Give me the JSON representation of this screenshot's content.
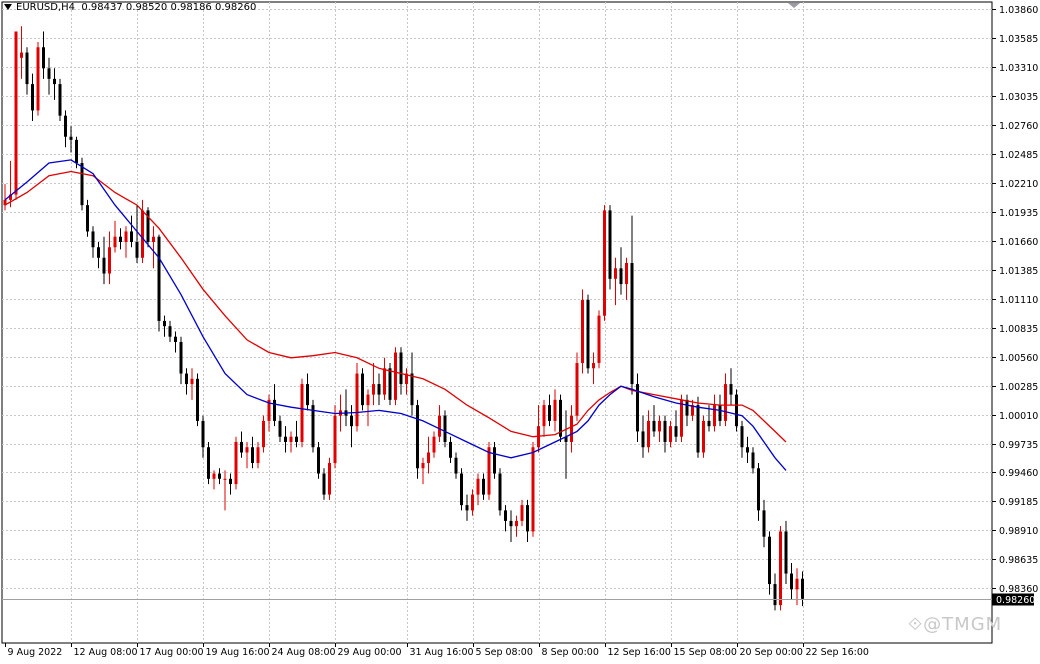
{
  "header": {
    "symbol": "EURUSD,H4",
    "ohlc": "0.98437 0.98520 0.98186 0.98260"
  },
  "watermark": "⟐@TMGM",
  "colors": {
    "background": "#ffffff",
    "grid": "#c8c8c8",
    "bull": "#e00000",
    "bear": "#000000",
    "ma_fast": "#0000cc",
    "ma_slow": "#e00000",
    "current_price_bg": "#000000",
    "current_price_fg": "#ffffff"
  },
  "chart_data": {
    "type": "candlestick",
    "title": "EURUSD,H4",
    "grid": true,
    "y_range": [
      0.9784,
      1.0393
    ],
    "y_ticks": [
      "1.03860",
      "1.03585",
      "1.03310",
      "1.03035",
      "1.02760",
      "1.02485",
      "1.02210",
      "1.01935",
      "1.01660",
      "1.01385",
      "1.01110",
      "1.00835",
      "1.00560",
      "1.00285",
      "1.00010",
      "0.99735",
      "0.99460",
      "0.99185",
      "0.98910",
      "0.98635",
      "0.98360"
    ],
    "current_price": "0.98260",
    "x_labels": [
      "9 Aug 2022",
      "12 Aug 08:00",
      "17 Aug 00:00",
      "19 Aug 16:00",
      "24 Aug 08:00",
      "29 Aug 00:00",
      "31 Aug 16:00",
      "5 Sep 08:00",
      "8 Sep 00:00",
      "12 Sep 16:00",
      "15 Sep 08:00",
      "20 Sep 00:00",
      "22 Sep 16:00"
    ],
    "candles": [
      [
        1.02,
        1.022,
        1.0195,
        1.0205
      ],
      [
        1.0205,
        1.0242,
        1.0198,
        1.021
      ],
      [
        1.021,
        1.0312,
        1.0205,
        1.0365
      ],
      [
        1.034,
        1.037,
        1.032,
        1.0345
      ],
      [
        1.0345,
        1.035,
        1.0305,
        1.0315
      ],
      [
        1.0315,
        1.0325,
        1.028,
        1.029
      ],
      [
        1.029,
        1.0355,
        1.0285,
        1.035
      ],
      [
        1.035,
        1.0365,
        1.032,
        1.033
      ],
      [
        1.033,
        1.034,
        1.0305,
        1.032
      ],
      [
        1.032,
        1.033,
        1.03,
        1.0315
      ],
      [
        1.0315,
        1.032,
        1.028,
        1.0285
      ],
      [
        1.0285,
        1.029,
        1.0255,
        1.0265
      ],
      [
        1.0265,
        1.0275,
        1.025,
        1.0262
      ],
      [
        1.0262,
        1.0265,
        1.0235,
        1.024
      ],
      [
        1.024,
        1.0245,
        1.0195,
        1.02
      ],
      [
        1.02,
        1.0205,
        1.017,
        1.0175
      ],
      [
        1.0175,
        1.018,
        1.015,
        1.016
      ],
      [
        1.016,
        1.0165,
        1.014,
        1.015
      ],
      [
        1.015,
        1.017,
        1.0125,
        1.0135
      ],
      [
        1.0135,
        1.0175,
        1.0125,
        1.016
      ],
      [
        1.016,
        1.0185,
        1.0155,
        1.017
      ],
      [
        1.017,
        1.0178,
        1.0158,
        1.0165
      ],
      [
        1.0165,
        1.018,
        1.015,
        1.0175
      ],
      [
        1.0175,
        1.019,
        1.016,
        1.0165
      ],
      [
        1.0165,
        1.02,
        1.0145,
        1.015
      ],
      [
        1.015,
        1.0205,
        1.0145,
        1.0195
      ],
      [
        1.0195,
        1.0198,
        1.016,
        1.0165
      ],
      [
        1.0165,
        1.018,
        1.014,
        1.017
      ],
      [
        1.017,
        1.0172,
        1.008,
        1.009
      ],
      [
        1.009,
        1.0095,
        1.0075,
        1.0085
      ],
      [
        1.0085,
        1.009,
        1.007,
        1.0075
      ],
      [
        1.0075,
        1.008,
        1.006,
        1.007
      ],
      [
        1.007,
        1.0075,
        1.003,
        1.004
      ],
      [
        1.004,
        1.0045,
        1.002,
        1.003
      ],
      [
        1.003,
        1.0045,
        1.0015,
        1.0035
      ],
      [
        1.0035,
        1.004,
        0.999,
        0.9995
      ],
      [
        0.9995,
        1.0,
        0.996,
        0.997
      ],
      [
        0.997,
        0.9975,
        0.9935,
        0.994
      ],
      [
        0.994,
        0.9948,
        0.993,
        0.9945
      ],
      [
        0.9945,
        0.995,
        0.9935,
        0.994
      ],
      [
        0.994,
        0.9948,
        0.991,
        0.994
      ],
      [
        0.994,
        0.9945,
        0.9925,
        0.9935
      ],
      [
        0.9935,
        0.998,
        0.993,
        0.9975
      ],
      [
        0.9975,
        0.9985,
        0.996,
        0.9965
      ],
      [
        0.9965,
        0.9975,
        0.995,
        0.997
      ],
      [
        0.997,
        0.998,
        0.995,
        0.9955
      ],
      [
        0.9955,
        0.9975,
        0.995,
        0.997
      ],
      [
        0.997,
        1.0,
        0.9965,
        0.9995
      ],
      [
        0.9995,
        1.002,
        0.9985,
        1.0015
      ],
      [
        1.0015,
        1.003,
        0.999,
        0.9995
      ],
      [
        0.9995,
        1.0,
        0.9975,
        0.998
      ],
      [
        0.998,
        0.999,
        0.9965,
        0.9975
      ],
      [
        0.9975,
        0.9985,
        0.9965,
        0.998
      ],
      [
        0.998,
        0.9995,
        0.997,
        0.9975
      ],
      [
        0.9975,
        1.0035,
        0.997,
        1.003
      ],
      [
        1.003,
        1.004,
        1.0005,
        1.001
      ],
      [
        1.001,
        1.0015,
        0.9965,
        0.997
      ],
      [
        0.997,
        0.9975,
        0.994,
        0.9945
      ],
      [
        0.9945,
        0.995,
        0.992,
        0.9925
      ],
      [
        0.9925,
        0.996,
        0.992,
        0.9955
      ],
      [
        0.9955,
        1.001,
        0.995,
        1.0
      ],
      [
        1.0,
        1.002,
        0.9985,
        1.0005
      ],
      [
        1.0005,
        1.0025,
        0.999,
        1.0
      ],
      [
        1.0,
        1.001,
        0.997,
        0.999
      ],
      [
        0.999,
        1.005,
        0.9985,
        1.004
      ],
      [
        1.004,
        1.0045,
        1.0005,
        1.001
      ],
      [
        1.001,
        1.0025,
        0.999,
        1.002
      ],
      [
        1.002,
        1.005,
        1.001,
        1.003
      ],
      [
        1.003,
        1.004,
        1.001,
        1.002
      ],
      [
        1.002,
        1.0055,
        1.0015,
        1.0045
      ],
      [
        1.0045,
        1.005,
        1.001,
        1.0015
      ],
      [
        1.0015,
        1.0065,
        1.001,
        1.006
      ],
      [
        1.006,
        1.0065,
        1.002,
        1.003
      ],
      [
        1.003,
        1.0045,
        1.002,
        1.004
      ],
      [
        1.004,
        1.006,
        1.0,
        1.001
      ],
      [
        1.001,
        1.0015,
        0.994,
        0.995
      ],
      [
        0.995,
        0.996,
        0.9935,
        0.9955
      ],
      [
        0.9955,
        0.998,
        0.9945,
        0.9965
      ],
      [
        0.9965,
        0.9985,
        0.996,
        0.998
      ],
      [
        0.998,
        1.001,
        0.9975,
        1.0
      ],
      [
        1.0,
        1.0005,
        0.997,
        0.9975
      ],
      [
        0.9975,
        0.998,
        0.9955,
        0.996
      ],
      [
        0.996,
        0.9965,
        0.994,
        0.9945
      ],
      [
        0.9945,
        0.995,
        0.991,
        0.9915
      ],
      [
        0.9915,
        0.9925,
        0.99,
        0.991
      ],
      [
        0.991,
        0.993,
        0.9905,
        0.9925
      ],
      [
        0.9925,
        0.9945,
        0.9915,
        0.994
      ],
      [
        0.994,
        0.9945,
        0.992,
        0.9925
      ],
      [
        0.9925,
        0.9975,
        0.992,
        0.997
      ],
      [
        0.997,
        0.9975,
        0.994,
        0.9945
      ],
      [
        0.9945,
        0.995,
        0.9905,
        0.991
      ],
      [
        0.991,
        0.9915,
        0.989,
        0.99
      ],
      [
        0.99,
        0.991,
        0.988,
        0.9895
      ],
      [
        0.9895,
        0.9905,
        0.9885,
        0.99
      ],
      [
        0.99,
        0.992,
        0.9895,
        0.9915
      ],
      [
        0.9915,
        0.992,
        0.988,
        0.989
      ],
      [
        0.989,
        0.9975,
        0.9885,
        0.997
      ],
      [
        0.997,
        1.001,
        0.9965,
        0.999
      ],
      [
        0.999,
        1.0015,
        0.998,
        1.001
      ],
      [
        1.001,
        1.002,
        0.999,
        0.9995
      ],
      [
        0.9995,
        1.0025,
        0.9985,
        1.0015
      ],
      [
        1.0015,
        1.002,
        0.9975,
        0.998
      ],
      [
        0.998,
        1.0005,
        0.994,
        0.9975
      ],
      [
        0.9975,
        1.001,
        0.9965,
        1.0
      ],
      [
        1.0,
        1.006,
        0.9995,
        1.005
      ],
      [
        1.005,
        1.012,
        1.004,
        1.011
      ],
      [
        1.011,
        1.0115,
        1.004,
        1.0045
      ],
      [
        1.0045,
        1.006,
        1.003,
        1.005
      ],
      [
        1.005,
        1.01,
        1.0045,
        1.0095
      ],
      [
        1.0095,
        1.02,
        1.009,
        1.0195
      ],
      [
        1.0195,
        1.02,
        1.012,
        1.013
      ],
      [
        1.013,
        1.015,
        1.0105,
        1.014
      ],
      [
        1.014,
        1.016,
        1.0115,
        1.0125
      ],
      [
        1.0125,
        1.015,
        1.011,
        1.0145
      ],
      [
        1.0145,
        1.019,
        1.002,
        1.003
      ],
      [
        1.003,
        1.004,
        0.9975,
        0.9985
      ],
      [
        0.9985,
        1.0,
        0.996,
        0.997
      ],
      [
        0.997,
        1.0005,
        0.9965,
        0.9995
      ],
      [
        0.9995,
        1.001,
        0.998,
        0.9985
      ],
      [
        0.9985,
        1.0,
        0.9975,
        0.9995
      ],
      [
        0.9995,
        1.0,
        0.9965,
        0.9975
      ],
      [
        0.9975,
        0.9995,
        0.997,
        0.999
      ],
      [
        0.999,
        1.0005,
        0.9975,
        0.998
      ],
      [
        0.998,
        1.002,
        0.9975,
        1.0015
      ],
      [
        1.0015,
        1.002,
        0.999,
        1.0
      ],
      [
        1.0,
        1.0015,
        0.9995,
        1.001
      ],
      [
        1.001,
        1.0018,
        0.996,
        0.9965
      ],
      [
        0.9965,
        1.0,
        0.996,
        0.9995
      ],
      [
        0.9995,
        1.001,
        0.9985,
        0.999
      ],
      [
        0.999,
        1.002,
        0.9985,
        1.001
      ],
      [
        1.001,
        1.002,
        0.999,
        0.9995
      ],
      [
        0.9995,
        1.004,
        0.999,
        1.003
      ],
      [
        1.003,
        1.0045,
        1.001,
        1.002
      ],
      [
        1.002,
        1.0025,
        0.9985,
        0.999
      ],
      [
        0.999,
        0.9995,
        0.996,
        0.997
      ],
      [
        0.997,
        0.998,
        0.9955,
        0.9965
      ],
      [
        0.9965,
        0.997,
        0.9945,
        0.995
      ],
      [
        0.995,
        0.9955,
        0.99,
        0.991
      ],
      [
        0.991,
        0.992,
        0.9875,
        0.9885
      ],
      [
        0.9885,
        0.989,
        0.983,
        0.984
      ],
      [
        0.984,
        0.985,
        0.9815,
        0.982
      ],
      [
        0.982,
        0.9895,
        0.9815,
        0.989
      ],
      [
        0.989,
        0.99,
        0.984,
        0.985
      ],
      [
        0.985,
        0.986,
        0.9825,
        0.9835
      ],
      [
        0.9835,
        0.9855,
        0.982,
        0.9845
      ],
      [
        0.9845,
        0.9852,
        0.9819,
        0.9826
      ]
    ],
    "ma_fast": {
      "color": "#0000cc",
      "points": [
        [
          0,
          1.0205
        ],
        [
          4,
          1.0222
        ],
        [
          8,
          1.024
        ],
        [
          12,
          1.0243
        ],
        [
          16,
          1.023
        ],
        [
          20,
          1.02
        ],
        [
          24,
          1.0175
        ],
        [
          28,
          1.015
        ],
        [
          32,
          1.0115
        ],
        [
          36,
          1.0075
        ],
        [
          40,
          1.004
        ],
        [
          44,
          1.002
        ],
        [
          48,
          1.0012
        ],
        [
          52,
          1.0008
        ],
        [
          56,
          1.0005
        ],
        [
          60,
          1.0002
        ],
        [
          64,
          1.0003
        ],
        [
          68,
          1.0005
        ],
        [
          72,
          1.0002
        ],
        [
          76,
          0.9995
        ],
        [
          80,
          0.9985
        ],
        [
          84,
          0.9975
        ],
        [
          88,
          0.9965
        ],
        [
          92,
          0.996
        ],
        [
          96,
          0.9965
        ],
        [
          100,
          0.9975
        ],
        [
          104,
          0.9985
        ],
        [
          106,
          0.9995
        ],
        [
          108,
          1.001
        ],
        [
          110,
          1.002
        ],
        [
          112,
          1.0028
        ],
        [
          114,
          1.0025
        ],
        [
          118,
          1.0018
        ],
        [
          122,
          1.0012
        ],
        [
          126,
          1.0008
        ],
        [
          130,
          1.0005
        ],
        [
          134,
          1.0
        ],
        [
          136,
          0.999
        ],
        [
          138,
          0.9975
        ],
        [
          140,
          0.996
        ],
        [
          142,
          0.9948
        ]
      ]
    },
    "ma_slow": {
      "color": "#e00000",
      "points": [
        [
          0,
          1.02
        ],
        [
          4,
          1.0212
        ],
        [
          8,
          1.0228
        ],
        [
          12,
          1.0232
        ],
        [
          16,
          1.0228
        ],
        [
          20,
          1.0212
        ],
        [
          24,
          1.02
        ],
        [
          28,
          1.0178
        ],
        [
          32,
          1.015
        ],
        [
          36,
          1.012
        ],
        [
          40,
          1.0095
        ],
        [
          44,
          1.0072
        ],
        [
          48,
          1.006
        ],
        [
          52,
          1.0055
        ],
        [
          56,
          1.0057
        ],
        [
          60,
          1.006
        ],
        [
          64,
          1.0055
        ],
        [
          68,
          1.0045
        ],
        [
          72,
          1.004
        ],
        [
          76,
          1.0035
        ],
        [
          80,
          1.0025
        ],
        [
          84,
          1.001
        ],
        [
          88,
          0.9998
        ],
        [
          92,
          0.9985
        ],
        [
          96,
          0.998
        ],
        [
          100,
          0.9982
        ],
        [
          104,
          0.9992
        ],
        [
          106,
          1.0005
        ],
        [
          108,
          1.0015
        ],
        [
          110,
          1.0022
        ],
        [
          112,
          1.0028
        ],
        [
          114,
          1.0024
        ],
        [
          118,
          1.002
        ],
        [
          122,
          1.0016
        ],
        [
          126,
          1.0012
        ],
        [
          130,
          1.001
        ],
        [
          134,
          1.001
        ],
        [
          136,
          1.0005
        ],
        [
          138,
          0.9995
        ],
        [
          140,
          0.9985
        ],
        [
          142,
          0.9975
        ]
      ]
    }
  }
}
